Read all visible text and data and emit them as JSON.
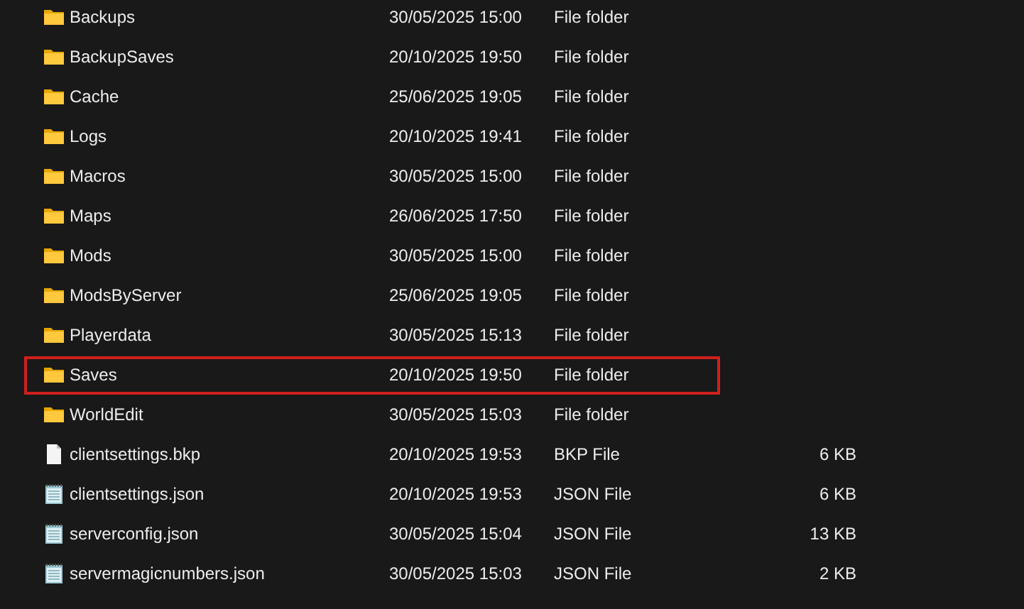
{
  "files": [
    {
      "kind": "folder",
      "name": "Backups",
      "date": "30/05/2025 15:00",
      "type": "File folder",
      "highlighted": false
    },
    {
      "kind": "folder",
      "name": "BackupSaves",
      "date": "20/10/2025 19:50",
      "type": "File folder",
      "highlighted": false
    },
    {
      "kind": "folder",
      "name": "Cache",
      "date": "25/06/2025 19:05",
      "type": "File folder",
      "highlighted": false
    },
    {
      "kind": "folder",
      "name": "Logs",
      "date": "20/10/2025 19:41",
      "type": "File folder",
      "highlighted": false
    },
    {
      "kind": "folder",
      "name": "Macros",
      "date": "30/05/2025 15:00",
      "type": "File folder",
      "highlighted": false
    },
    {
      "kind": "folder",
      "name": "Maps",
      "date": "26/06/2025 17:50",
      "type": "File folder",
      "highlighted": false
    },
    {
      "kind": "folder",
      "name": "Mods",
      "date": "30/05/2025 15:00",
      "type": "File folder",
      "highlighted": false
    },
    {
      "kind": "folder",
      "name": "ModsByServer",
      "date": "25/06/2025 19:05",
      "type": "File folder",
      "highlighted": false
    },
    {
      "kind": "folder",
      "name": "Playerdata",
      "date": "30/05/2025 15:13",
      "type": "File folder",
      "highlighted": false
    },
    {
      "kind": "folder",
      "name": "Saves",
      "date": "20/10/2025 19:50",
      "type": "File folder",
      "highlighted": true
    },
    {
      "kind": "folder",
      "name": "WorldEdit",
      "date": "30/05/2025 15:03",
      "type": "File folder",
      "highlighted": false
    },
    {
      "kind": "file",
      "name": "clientsettings.bkp",
      "date": "20/10/2025 19:53",
      "type": "BKP File",
      "size": "6 KB",
      "highlighted": false
    },
    {
      "kind": "text",
      "name": "clientsettings.json",
      "date": "20/10/2025 19:53",
      "type": "JSON File",
      "size": "6 KB",
      "highlighted": false
    },
    {
      "kind": "text",
      "name": "serverconfig.json",
      "date": "30/05/2025 15:04",
      "type": "JSON File",
      "size": "13 KB",
      "highlighted": false
    },
    {
      "kind": "text",
      "name": "servermagicnumbers.json",
      "date": "30/05/2025 15:03",
      "type": "JSON File",
      "size": "2 KB",
      "highlighted": false
    }
  ]
}
